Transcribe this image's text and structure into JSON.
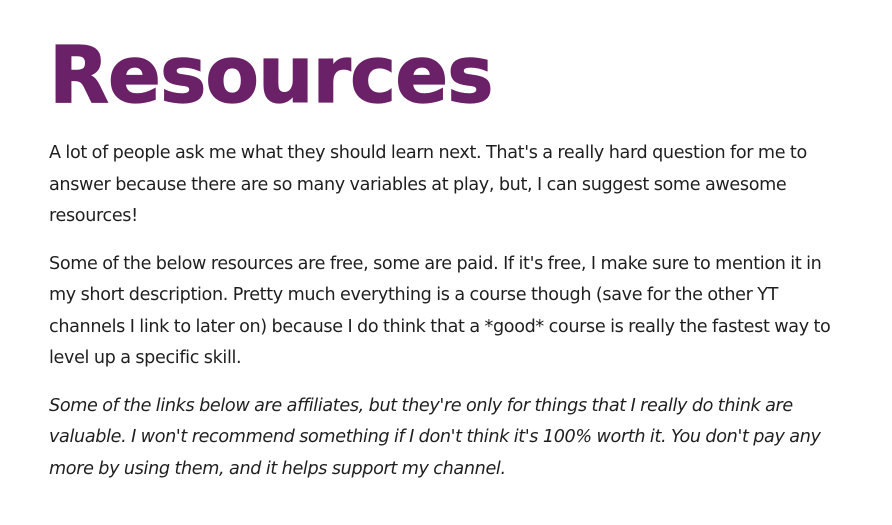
{
  "page": {
    "title": "Resources",
    "paragraphs": [
      "A lot of people ask me what they should learn next. That's a really hard question for me to answer because there are so many variables at play, but, I can suggest some awesome resources!",
      "Some of the below resources are free, some are paid. If it's free, I make sure to mention it in my short description. Pretty much everything is a course though (save for the other YT channels I link to later on) because I do think that a *good* course is really the fastest way to level up a specific skill.",
      "Some of the links below are affiliates, but they're only for things that I really do think are valuable. I won't recommend something if I don't think it's 100% worth it. You don't pay any more by using them, and it helps support my channel."
    ]
  },
  "colors": {
    "title": "#6a2167",
    "body_text": "#1f1f1f",
    "background": "#ffffff"
  }
}
